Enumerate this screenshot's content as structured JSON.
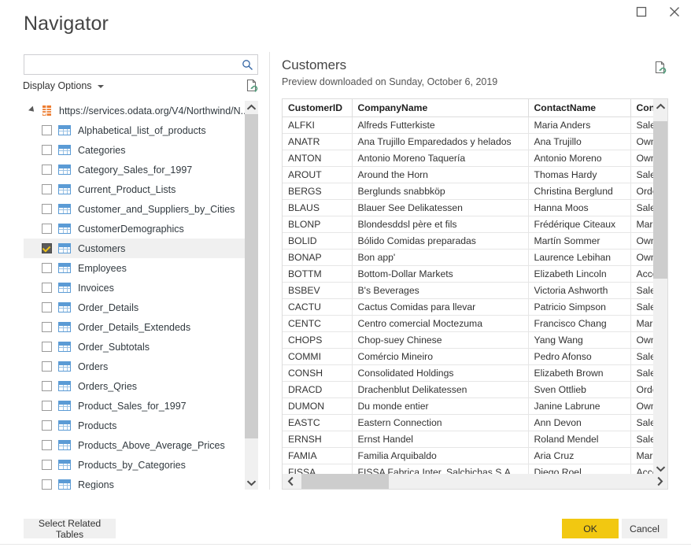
{
  "window": {
    "title": "Navigator",
    "controls": [
      {
        "name": "maximize",
        "glyph": "maximize-icon"
      },
      {
        "name": "close",
        "glyph": "close-icon"
      }
    ]
  },
  "left_pane": {
    "search": {
      "value": "",
      "placeholder": ""
    },
    "display_options_label": "Display Options",
    "refresh_icon": "refresh-page-icon",
    "tree": {
      "root": {
        "label": "https://services.odata.org/V4/Northwind/N...",
        "icon": "odata-feed-icon",
        "expanded": true
      },
      "items": [
        {
          "label": "Alphabetical_list_of_products",
          "checked": false,
          "selected": false,
          "icon": "table-icon"
        },
        {
          "label": "Categories",
          "checked": false,
          "selected": false,
          "icon": "table-icon"
        },
        {
          "label": "Category_Sales_for_1997",
          "checked": false,
          "selected": false,
          "icon": "table-icon"
        },
        {
          "label": "Current_Product_Lists",
          "checked": false,
          "selected": false,
          "icon": "table-icon"
        },
        {
          "label": "Customer_and_Suppliers_by_Cities",
          "checked": false,
          "selected": false,
          "icon": "table-icon"
        },
        {
          "label": "CustomerDemographics",
          "checked": false,
          "selected": false,
          "icon": "table-icon"
        },
        {
          "label": "Customers",
          "checked": true,
          "selected": true,
          "icon": "table-icon"
        },
        {
          "label": "Employees",
          "checked": false,
          "selected": false,
          "icon": "table-icon"
        },
        {
          "label": "Invoices",
          "checked": false,
          "selected": false,
          "icon": "table-icon"
        },
        {
          "label": "Order_Details",
          "checked": false,
          "selected": false,
          "icon": "table-icon"
        },
        {
          "label": "Order_Details_Extendeds",
          "checked": false,
          "selected": false,
          "icon": "table-icon"
        },
        {
          "label": "Order_Subtotals",
          "checked": false,
          "selected": false,
          "icon": "table-icon"
        },
        {
          "label": "Orders",
          "checked": false,
          "selected": false,
          "icon": "table-icon"
        },
        {
          "label": "Orders_Qries",
          "checked": false,
          "selected": false,
          "icon": "table-icon"
        },
        {
          "label": "Product_Sales_for_1997",
          "checked": false,
          "selected": false,
          "icon": "table-icon"
        },
        {
          "label": "Products",
          "checked": false,
          "selected": false,
          "icon": "table-icon"
        },
        {
          "label": "Products_Above_Average_Prices",
          "checked": false,
          "selected": false,
          "icon": "table-icon"
        },
        {
          "label": "Products_by_Categories",
          "checked": false,
          "selected": false,
          "icon": "table-icon"
        },
        {
          "label": "Regions",
          "checked": false,
          "selected": false,
          "icon": "table-icon"
        }
      ]
    }
  },
  "right_pane": {
    "title": "Customers",
    "subtitle": "Preview downloaded on Sunday, October 6, 2019",
    "refresh_icon": "refresh-preview-icon",
    "grid": {
      "columns": [
        "CustomerID",
        "CompanyName",
        "ContactName",
        "ContactTitle"
      ],
      "rows": [
        [
          "ALFKI",
          "Alfreds Futterkiste",
          "Maria Anders",
          "Sales Representative"
        ],
        [
          "ANATR",
          "Ana Trujillo Emparedados y helados",
          "Ana Trujillo",
          "Owner"
        ],
        [
          "ANTON",
          "Antonio Moreno Taquería",
          "Antonio Moreno",
          "Owner"
        ],
        [
          "AROUT",
          "Around the Horn",
          "Thomas Hardy",
          "Sales Representative"
        ],
        [
          "BERGS",
          "Berglunds snabbköp",
          "Christina Berglund",
          "Order Administrator"
        ],
        [
          "BLAUS",
          "Blauer See Delikatessen",
          "Hanna Moos",
          "Sales Representative"
        ],
        [
          "BLONP",
          "Blondesddsl père et fils",
          "Frédérique Citeaux",
          "Marketing Manager"
        ],
        [
          "BOLID",
          "Bólido Comidas preparadas",
          "Martín Sommer",
          "Owner"
        ],
        [
          "BONAP",
          "Bon app'",
          "Laurence Lebihan",
          "Owner"
        ],
        [
          "BOTTM",
          "Bottom-Dollar Markets",
          "Elizabeth Lincoln",
          "Accounting Manager"
        ],
        [
          "BSBEV",
          "B's Beverages",
          "Victoria Ashworth",
          "Sales Representative"
        ],
        [
          "CACTU",
          "Cactus Comidas para llevar",
          "Patricio Simpson",
          "Sales Agent"
        ],
        [
          "CENTC",
          "Centro comercial Moctezuma",
          "Francisco Chang",
          "Marketing Manager"
        ],
        [
          "CHOPS",
          "Chop-suey Chinese",
          "Yang Wang",
          "Owner"
        ],
        [
          "COMMI",
          "Comércio Mineiro",
          "Pedro Afonso",
          "Sales Associate"
        ],
        [
          "CONSH",
          "Consolidated Holdings",
          "Elizabeth Brown",
          "Sales Representative"
        ],
        [
          "DRACD",
          "Drachenblut Delikatessen",
          "Sven Ottlieb",
          "Order Administrator"
        ],
        [
          "DUMON",
          "Du monde entier",
          "Janine Labrune",
          "Owner"
        ],
        [
          "EASTC",
          "Eastern Connection",
          "Ann Devon",
          "Sales Agent"
        ],
        [
          "ERNSH",
          "Ernst Handel",
          "Roland Mendel",
          "Sales Manager"
        ],
        [
          "FAMIA",
          "Familia Arquibaldo",
          "Aria Cruz",
          "Marketing Assistant"
        ],
        [
          "FISSA",
          "FISSA Fabrica Inter. Salchichas S.A.",
          "Diego Roel",
          "Accounting Manager"
        ]
      ]
    }
  },
  "footer": {
    "select_related_label": "Select Related Tables",
    "ok_label": "OK",
    "cancel_label": "Cancel"
  },
  "colors": {
    "accent_yellow": "#f2c811",
    "feed_orange": "#ed7d31",
    "table_blue": "#5b9bd5",
    "selection_gray": "#f0f0f0"
  }
}
